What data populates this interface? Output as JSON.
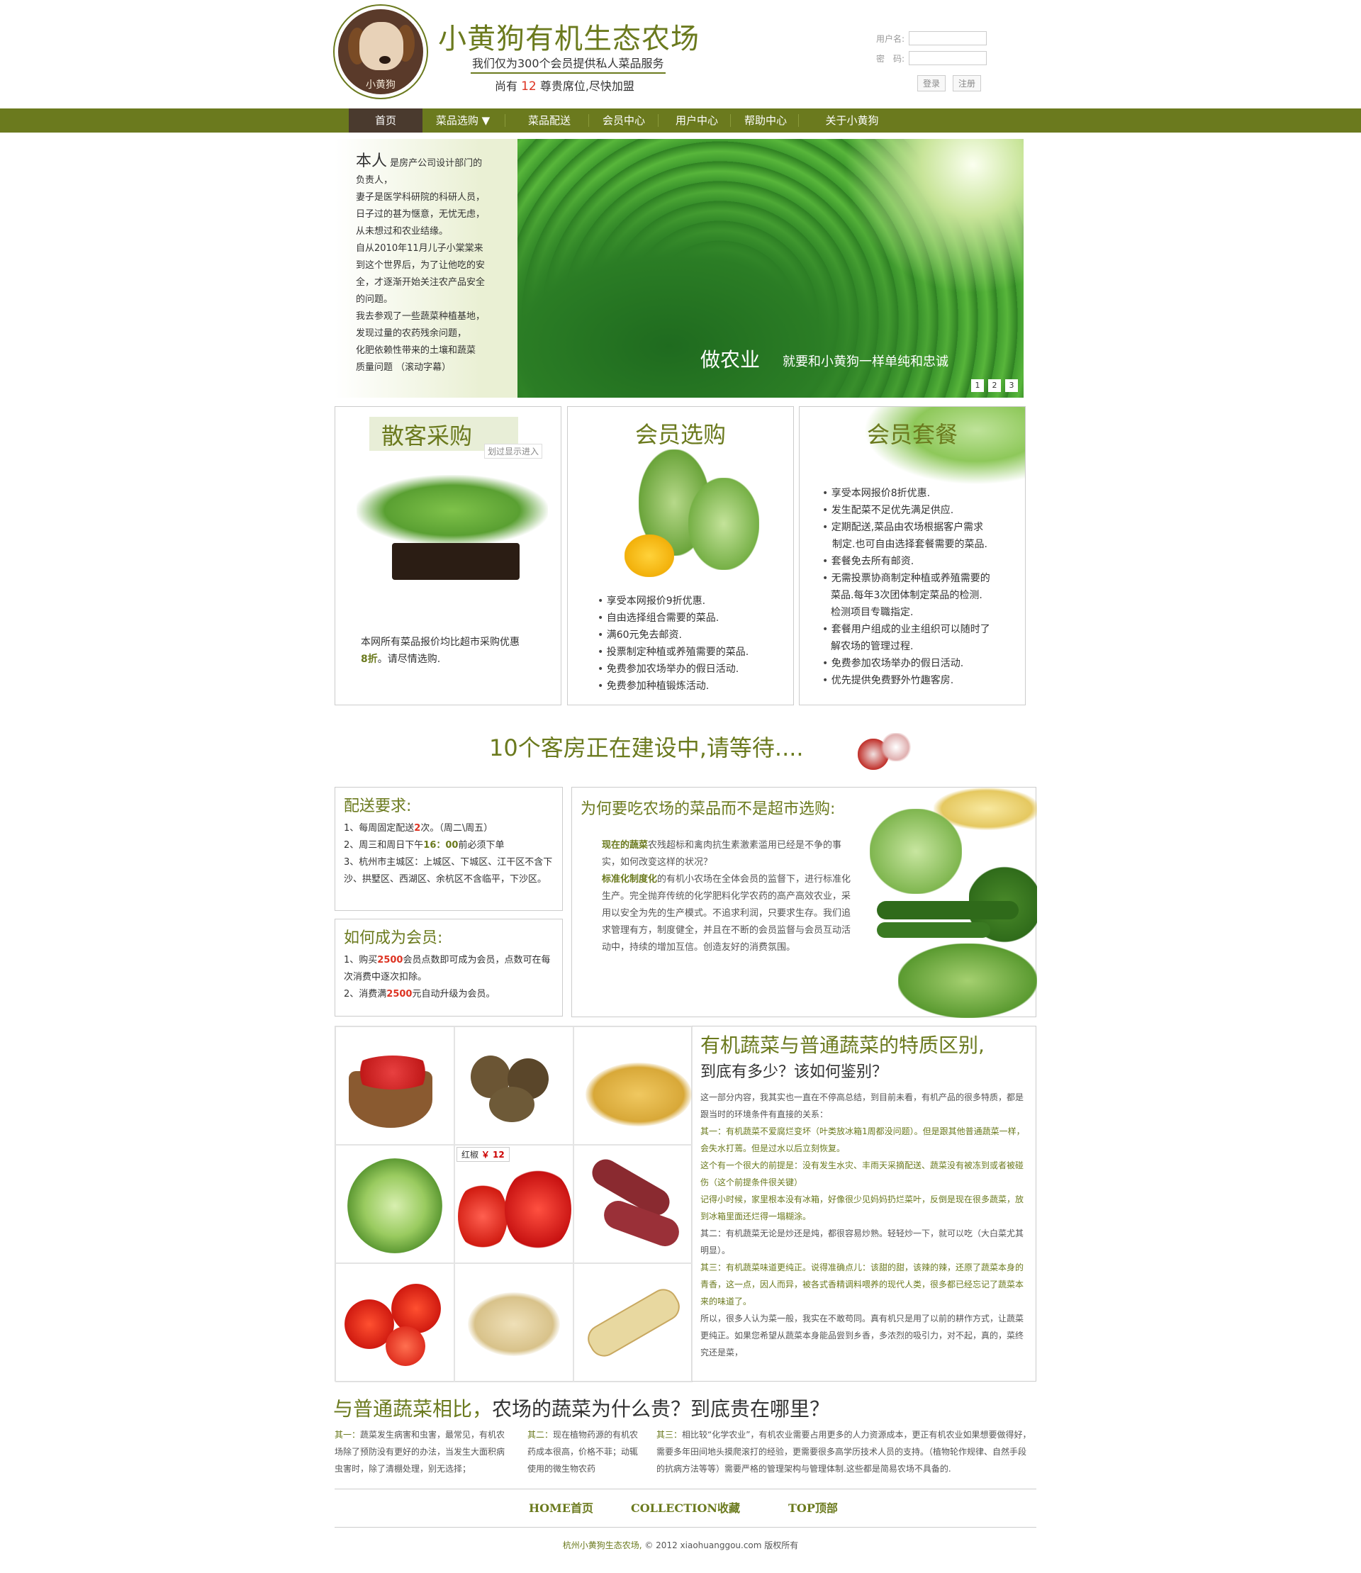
{
  "header": {
    "title": "小黄狗有机生态农场",
    "logo_text": "小黄狗",
    "tagline": "我们仅为300个会员提供私人菜品服务",
    "seats_prefix": "尚有",
    "seats_count": "12",
    "seats_suffix": "尊贵席位,尽快加盟",
    "username_label": "用户名:",
    "password_label": "密　码:",
    "login_btn": "登录",
    "register_btn": "注册"
  },
  "nav": [
    "首页",
    "菜品选购 ▼",
    "菜品配送",
    "会员中心",
    "用户中心",
    "帮助中心",
    "关于小黄狗"
  ],
  "banner": {
    "intro_big": "本人",
    "intro_lines": [
      " 是房产公司设计部门的",
      "负责人，",
      "妻子是医学科研院的科研人员，",
      "日子过的甚为惬意，无忧无虑，",
      "从未想过和农业结缘。",
      "自从2010年11月儿子小棠棠来",
      "到这个世界后，为了让他吃的安",
      "全，才逐渐开始关注农产品安全",
      "的问题。",
      "我去参观了一些蔬菜种植基地，",
      "发现过量的农药残余问题，",
      "化肥依赖性带来的土壤和蔬菜",
      "质量问题 （滚动字幕）"
    ],
    "caption": "做农业",
    "caption_sub": "就要和小黄狗一样单纯和忠诚",
    "dots": [
      "1",
      "2",
      "3"
    ]
  },
  "panels": [
    {
      "title": "散客采购",
      "hint": "划过显示进入",
      "text": "本网所有菜品报价均比超市采购优惠",
      "discount": "8折",
      "text_end": "。请尽情选购."
    },
    {
      "title": "会员选购",
      "items": [
        "享受本网报价9折优惠.",
        "自由选择组合需要的菜品.",
        "满60元免去邮资.",
        "投票制定种植或养殖需要的菜品.",
        "免费参加农场举办的假日活动.",
        "免费参加种植锻炼活动."
      ]
    },
    {
      "title": "会员套餐",
      "items": [
        "享受本网报价8折优惠.",
        "发生配菜不足优先满足供应.",
        "定期配送,菜品由农场根据客户需求",
        "制定.也可自由选择套餐需要的菜品.",
        "套餐免去所有邮资.",
        "无需投票协商制定种植或养殖需要的",
        "菜品.每年3次团体制定菜品的检测.",
        "检测项目专職指定.",
        "套餐用户组成的业主组织可以随时了",
        "解农场的管理过程.",
        "免费参加农场举办的假日活动.",
        "优先提供免费野外竹趣客房."
      ]
    }
  ],
  "construction": "10个客房正在建设中,请等待....",
  "delivery": {
    "title": "配送要求:",
    "l1a": "1、每周固定配送",
    "l1b": "2",
    "l1c": "次。（周二\\周五）",
    "l2a": "2、周三和周日下午",
    "l2b": "16：00",
    "l2c": "前必须下单",
    "l3": "3、杭州市主城区：上城区、下城区、江干区不含下沙、拱墅区、西湖区、余杭区不含临平，下沙区。"
  },
  "member": {
    "title": "如何成为会员:",
    "l1a": "1、购买",
    "l1b": "2500",
    "l1c": "会员点数即可成为会员，点数可在每次消费中逐次扣除。",
    "l2a": "2、消费满",
    "l2b": "2500",
    "l2c": "元自动升级为会员。"
  },
  "why": {
    "title": "为何要吃农场的菜品而不是超市选购:",
    "p1b": "现在的蔬菜",
    "p1": "农残超标和禽肉抗生素激素滥用已经是不争的事实，如何改变这样的状况？",
    "p2b": "标准化制度化",
    "p2": "的有机小农场在全体会员的监督下，进行标准化生产。完全抛弃传统的化学肥料化学农药的高产高效农业，采用以安全为先的生产模式。不追求利润，只要求生存。我们追求管理有方，制度健全，并且在不断的会员监督与会员互动活动中，持续的增加互信。创造友好的消费氛围。"
  },
  "price_tag": {
    "name": "红椒",
    "price": "￥ 12"
  },
  "diff": {
    "title": "有机蔬菜与普通蔬菜的特质区别,",
    "subtitle": "到底有多少？该如何鉴别？",
    "paras": [
      {
        "t": "这一部分内容，我其实也一直在不停高总结，到目前未看，有机产品的很多特质，都是跟当时的环境条件有直接的关系：",
        "g": false
      },
      {
        "t": "其一：有机蔬菜不爱腐烂变坏（叶类放冰箱1周都没问题）。但是跟其他普通蔬菜一样，会失水打蔫。但是过水以后立刻恢复。",
        "g": true
      },
      {
        "t": "这个有一个很大的前提是：没有发生水灾、丰雨天采摘配送、蔬菜没有被冻到或者被碰伤（这个前提条件很关键）",
        "g": true
      },
      {
        "t": "记得小时候，家里根本没有冰箱，好像很少见妈妈扔烂菜叶，反倒是现在很多蔬菜，放到冰箱里面还烂得一塌糊涂。",
        "g": true
      },
      {
        "t": "其二：有机蔬菜无论是炒还是炖，都很容易炒熟。轻轻炒一下，就可以吃（大白菜尤其明显）。",
        "g": false
      },
      {
        "t": "其三：有机蔬菜味道更纯正。说得准确点儿：该甜的甜，该辣的辣，还原了蔬菜本身的青香，这一点，因人而异，被各式香精调料喂养的现代人类，很多都已经忘记了蔬菜本来的味道了。",
        "g": true
      },
      {
        "t": "所以，很多人认为菜一般，我实在不敢苟同。真有机只是用了以前的耕作方式，让蔬菜更纯正。如果您希望从蔬菜本身能品尝到乡香，多浓烈的吸引力，对不起，真的，菜终究还是菜，",
        "g": false
      }
    ]
  },
  "price_section": {
    "title_a": "与普通蔬菜相比，",
    "title_b": "农场的蔬菜为什么贵？到底贵在哪里？",
    "c1h": "其一：",
    "c1": "蔬菜发生病害和虫害，最常见，有机农场除了预防没有更好的办法，当发生大面积病虫害时，除了清棚处理，别无选择；",
    "c2h": "其二：",
    "c2": "现在植物药源的有机农药成本很高，价格不菲；动辄使用的微生物农药",
    "c3h": "其三：",
    "c3": "相比较“化学农业”，有机农业需要占用更多的人力资源成本，更正有机农业如果想要做得好，需要多年田间地头摸爬滚打的经验，更需要很多高学历技术人员的支持。（植物轮作规律、自然手段的抗病方法等等）需要严格的管理架构与管理体制.这些都是简易农场不具备的."
  },
  "footer": {
    "home": "HOME首页",
    "collect": "COLLECTION收藏",
    "top": "TOP顶部",
    "copy_a": "杭州小黄狗生态农场,",
    "copy_b": "© 2012 xiaohuanggou.com 版权所有"
  },
  "colors": {
    "brand": "#6b7a1e",
    "accent": "#d32"
  }
}
